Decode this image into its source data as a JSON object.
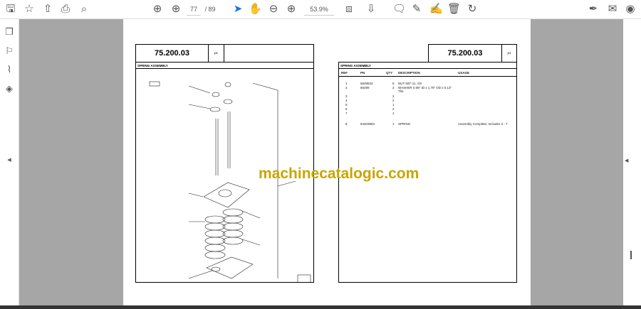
{
  "toolbar": {
    "page_current": "77",
    "page_total": "/ 89",
    "zoom": "53.9%",
    "icons": [
      "save-icon",
      "bookmark-star-icon",
      "upload-icon",
      "print-icon",
      "zoom-search-icon",
      "prev-page-icon",
      "next-page-icon",
      "select-cursor-icon",
      "hand-icon",
      "zoom-out-icon",
      "zoom-in-icon",
      "fit-page-icon",
      "scroll-mode-icon",
      "comment-icon",
      "highlight-pen-icon",
      "sign-icon",
      "delete-icon",
      "rotate-icon",
      "fill-sign-icon",
      "email-icon",
      "account-icon"
    ]
  },
  "sidebar": {
    "icons": [
      "pages-icon",
      "bookmarks-icon",
      "attachments-icon",
      "layers-icon"
    ]
  },
  "left_page": {
    "number": "75.200.03",
    "page_label": "p1",
    "title": "SPRING ASSEMBLY"
  },
  "right_page": {
    "number": "75.200.03",
    "page_label": "p1",
    "title": "SPRING ASSEMBLY",
    "columns": [
      "REF",
      "PN",
      "QTY",
      "DESCRIPTION",
      "USAGE"
    ],
    "rows": [
      [
        "1",
        "5849623",
        "6",
        "NUT 5/8\"-11, G5",
        ""
      ],
      [
        "2",
        "80299",
        "2",
        "WASHER 0.69\" ID x 1.75\" OD x 0.13\" Thk",
        ""
      ],
      [
        "3",
        "",
        "2",
        "",
        ""
      ],
      [
        "4",
        "",
        "2",
        "",
        ""
      ],
      [
        "5",
        "",
        "1",
        "",
        ""
      ],
      [
        "6",
        "",
        "2",
        "",
        ""
      ],
      [
        "7",
        "",
        "1",
        "",
        ""
      ],
      [
        "8",
        "84403853",
        "1",
        "SPRING",
        "Assembly Complete; Includes 3 - 7"
      ]
    ]
  },
  "watermark": "machinecatalogic.com"
}
